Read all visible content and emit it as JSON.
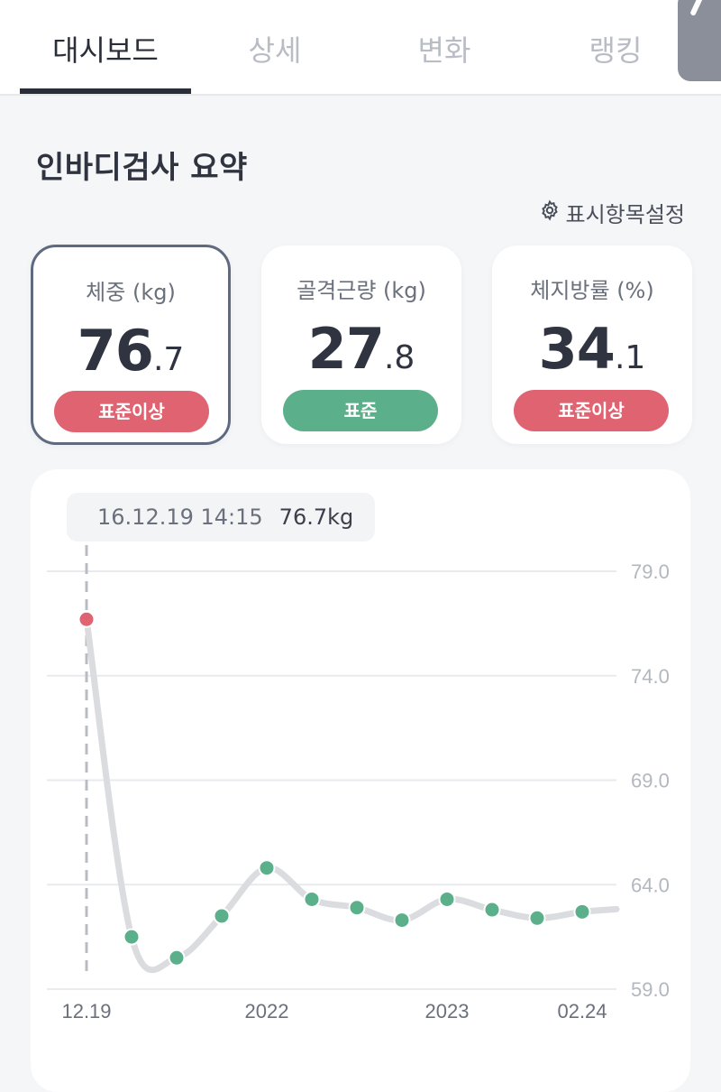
{
  "tabs": [
    {
      "label": "대시보드",
      "active": true
    },
    {
      "label": "상세",
      "active": false
    },
    {
      "label": "변화",
      "active": false
    },
    {
      "label": "랭킹",
      "active": false
    }
  ],
  "section": {
    "title": "인바디검사 요약",
    "settings_label": "표시항목설정",
    "settings_icon": "gear-icon"
  },
  "cards": [
    {
      "label": "체중 (kg)",
      "value_int": "76",
      "value_dec": ".7",
      "badge": "표준이상",
      "status": "over",
      "selected": true
    },
    {
      "label": "골격근량 (kg)",
      "value_int": "27",
      "value_dec": ".8",
      "badge": "표준",
      "status": "normal",
      "selected": false
    },
    {
      "label": "체지방률 (%)",
      "value_int": "34",
      "value_dec": ".1",
      "badge": "표준이상",
      "status": "over",
      "selected": false
    }
  ],
  "tooltip": {
    "date": "16.12.19 14:15",
    "value": "76.7kg"
  },
  "colors": {
    "over": "#e06372",
    "normal": "#5bb08b",
    "line": "#dadce0",
    "accent": "#2a2e38"
  },
  "chart_data": {
    "type": "line",
    "series": [
      {
        "x": [
          "12.19",
          "",
          "",
          "",
          "2022",
          "",
          "",
          "",
          "2023",
          "",
          "",
          "02.24"
        ],
        "values": [
          76.7,
          61.5,
          60.5,
          62.5,
          64.8,
          63.3,
          62.9,
          62.3,
          63.3,
          62.8,
          62.4,
          62.7
        ]
      }
    ],
    "x_tick_labels": [
      "12.19",
      "2022",
      "2023",
      "02.24"
    ],
    "y_tick_labels": [
      "79.0",
      "74.0",
      "69.0",
      "64.0",
      "59.0"
    ],
    "ylim": [
      59.0,
      79.0
    ],
    "grid": true,
    "highlight_index": 0
  }
}
